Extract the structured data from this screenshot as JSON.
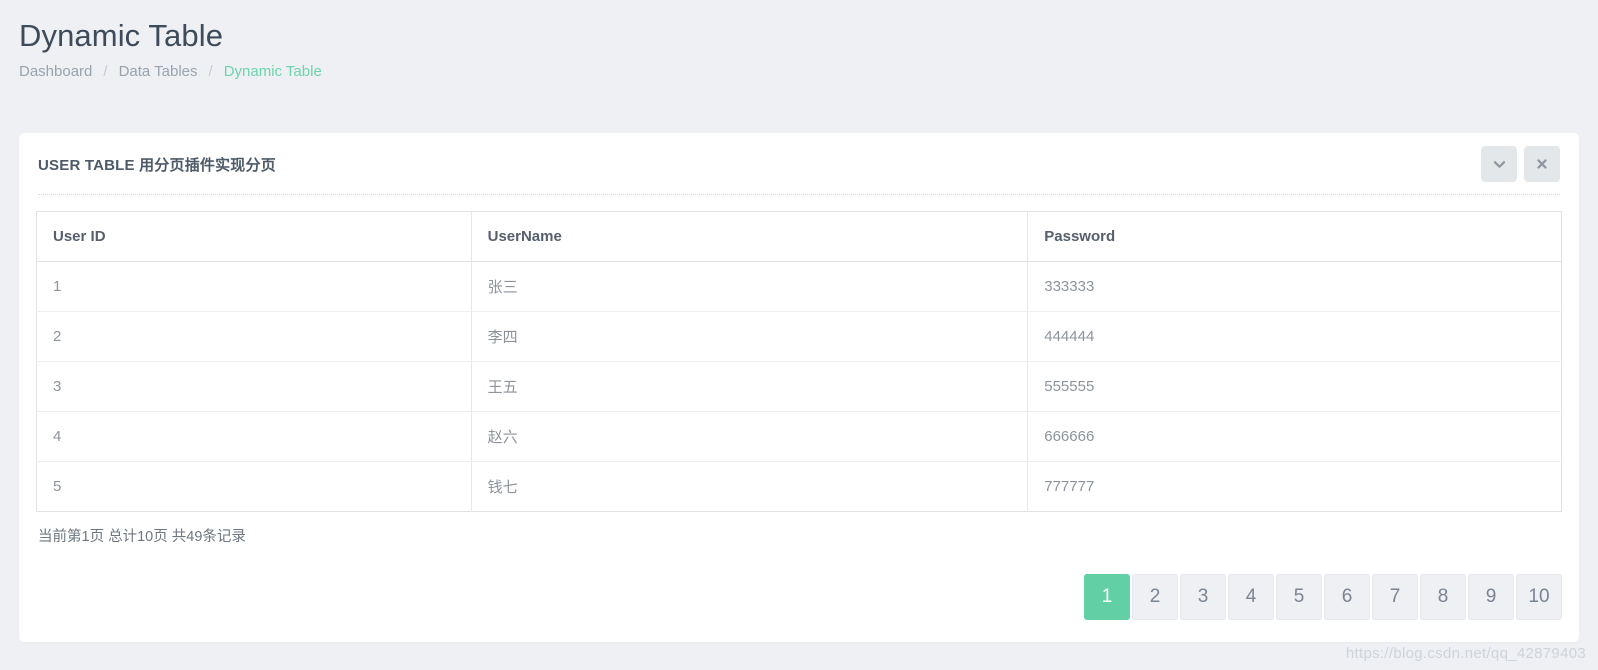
{
  "page": {
    "title": "Dynamic Table"
  },
  "breadcrumb": {
    "separator": "/",
    "items": [
      {
        "label": "Dashboard",
        "active": false
      },
      {
        "label": "Data Tables",
        "active": false
      },
      {
        "label": "Dynamic Table",
        "active": true
      }
    ]
  },
  "card": {
    "title": "USER TABLE 用分页插件实现分页",
    "actions": [
      {
        "name": "collapse-button",
        "icon": "chevron-down-icon"
      },
      {
        "name": "close-button",
        "icon": "close-icon"
      }
    ]
  },
  "table": {
    "columns": [
      "User ID",
      "UserName",
      "Password"
    ],
    "rows": [
      {
        "id": "1",
        "username": "张三",
        "password": "333333"
      },
      {
        "id": "2",
        "username": "李四",
        "password": "444444"
      },
      {
        "id": "3",
        "username": "王五",
        "password": "555555"
      },
      {
        "id": "4",
        "username": "赵六",
        "password": "666666"
      },
      {
        "id": "5",
        "username": "钱七",
        "password": "777777"
      }
    ]
  },
  "pagination": {
    "info": "当前第1页 总计10页 共49条记录",
    "current_page": 1,
    "total_pages": 10,
    "total_records": 49,
    "pages": [
      "1",
      "2",
      "3",
      "4",
      "5",
      "6",
      "7",
      "8",
      "9",
      "10"
    ]
  },
  "watermark": {
    "text": "https://blog.csdn.net/qq_42879403"
  },
  "colors": {
    "accent_green": "#62cfa4",
    "page_background": "#eef0f4",
    "card_background": "#ffffff",
    "title_text": "#3e4b5b",
    "muted_text": "#9aa3ae"
  }
}
